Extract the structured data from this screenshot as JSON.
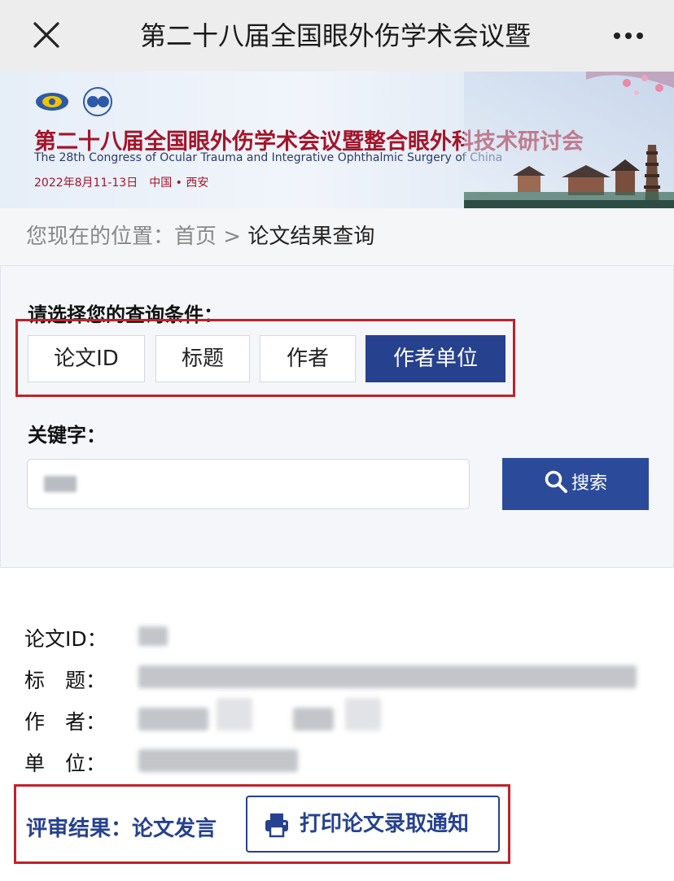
{
  "topbar": {
    "title": "第二十八届全国眼外伤学术会议暨"
  },
  "banner": {
    "title": "第二十八届全国眼外伤学术会议暨整合眼外科技术研讨会",
    "subtitle": "The 28th Congress of Ocular Trauma and Integrative Ophthalmic Surgery of China",
    "date": "2022年8月11-13日　中国 • 西安"
  },
  "breadcrumb": {
    "prefix": "您现在的位置：",
    "home": "首页",
    "separator": " > ",
    "current": "论文结果查询"
  },
  "query": {
    "condition_label": "请选择您的查询条件：",
    "options": [
      {
        "label": "论文ID",
        "active": false
      },
      {
        "label": "标题",
        "active": false
      },
      {
        "label": "作者",
        "active": false
      },
      {
        "label": "作者单位",
        "active": true
      }
    ],
    "keyword_label": "关键字：",
    "search_label": "搜索"
  },
  "result": {
    "id_label": "论文ID：",
    "title_label": "标　题：",
    "author_label": "作　者：",
    "unit_label": "单　位：",
    "review_label": "评审结果：论文发言",
    "print_label": "打印论文录取通知"
  },
  "colors": {
    "accent": "#26418e",
    "highlight": "#c0222b",
    "banner_title": "#a3152a"
  }
}
